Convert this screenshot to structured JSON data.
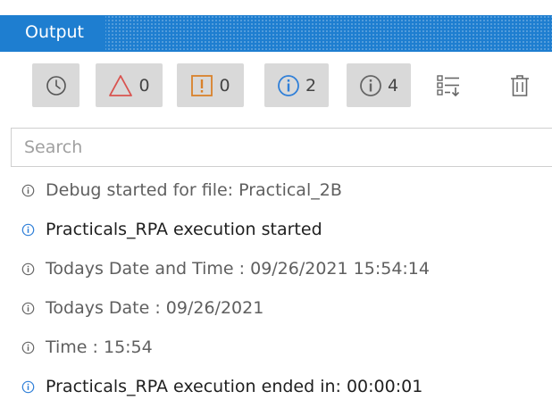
{
  "panel": {
    "title": "Output"
  },
  "toolbar": {
    "buttons": [
      {
        "name": "timestamps",
        "icon": "clock-icon"
      },
      {
        "name": "errors",
        "icon": "error-triangle-icon",
        "count": "0",
        "color": "#d9534f"
      },
      {
        "name": "warnings",
        "icon": "warning-box-icon",
        "count": "0",
        "color": "#d9812a"
      },
      {
        "name": "info",
        "icon": "info-circle-icon",
        "count": "2",
        "color": "#2f7fd8"
      },
      {
        "name": "trace",
        "icon": "trace-circle-icon",
        "count": "4",
        "color": "#666666"
      },
      {
        "name": "sort",
        "icon": "sort-list-icon"
      },
      {
        "name": "clear",
        "icon": "trash-icon"
      }
    ]
  },
  "search": {
    "placeholder": "Search",
    "value": ""
  },
  "log": [
    {
      "level": "trace",
      "text": "Debug started for file: Practical_2B"
    },
    {
      "level": "info",
      "text": "Practicals_RPA execution started"
    },
    {
      "level": "trace",
      "text": "Todays Date and Time : 09/26/2021 15:54:14"
    },
    {
      "level": "trace",
      "text": "Todays Date : 09/26/2021"
    },
    {
      "level": "trace",
      "text": "Time : 15:54"
    },
    {
      "level": "info",
      "text": "Practicals_RPA execution ended in: 00:00:01"
    }
  ],
  "colors": {
    "titlebar": "#1e7ed0",
    "info_icon": "#2f7fd8",
    "trace_icon": "#666666"
  }
}
